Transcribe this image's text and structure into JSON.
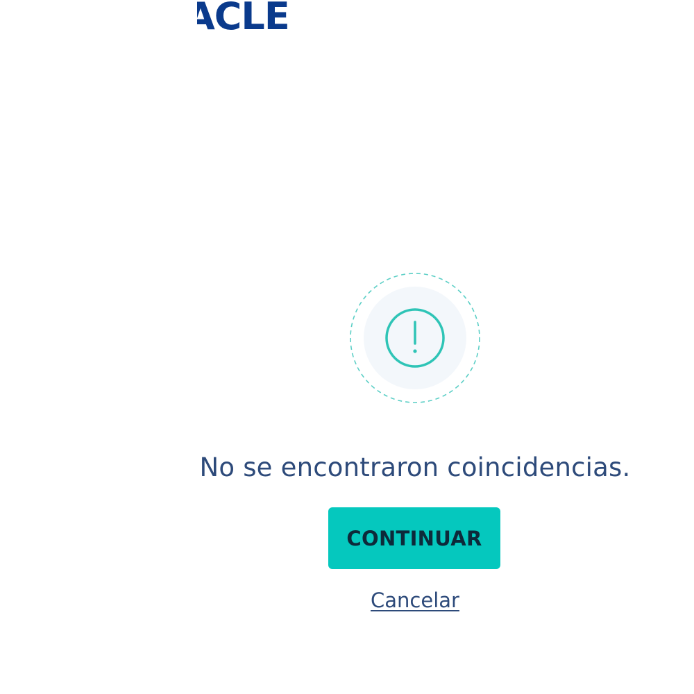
{
  "brand": {
    "logo_text": "ACLE",
    "color": "#0a3a8c"
  },
  "status": {
    "icon": "exclamation-circle-icon",
    "accent_color": "#2ec4b6",
    "message": "No se encontraron coincidencias."
  },
  "actions": {
    "continue_label": "CONTINUAR",
    "continue_color": "#05c8be",
    "cancel_label": "Cancelar"
  }
}
